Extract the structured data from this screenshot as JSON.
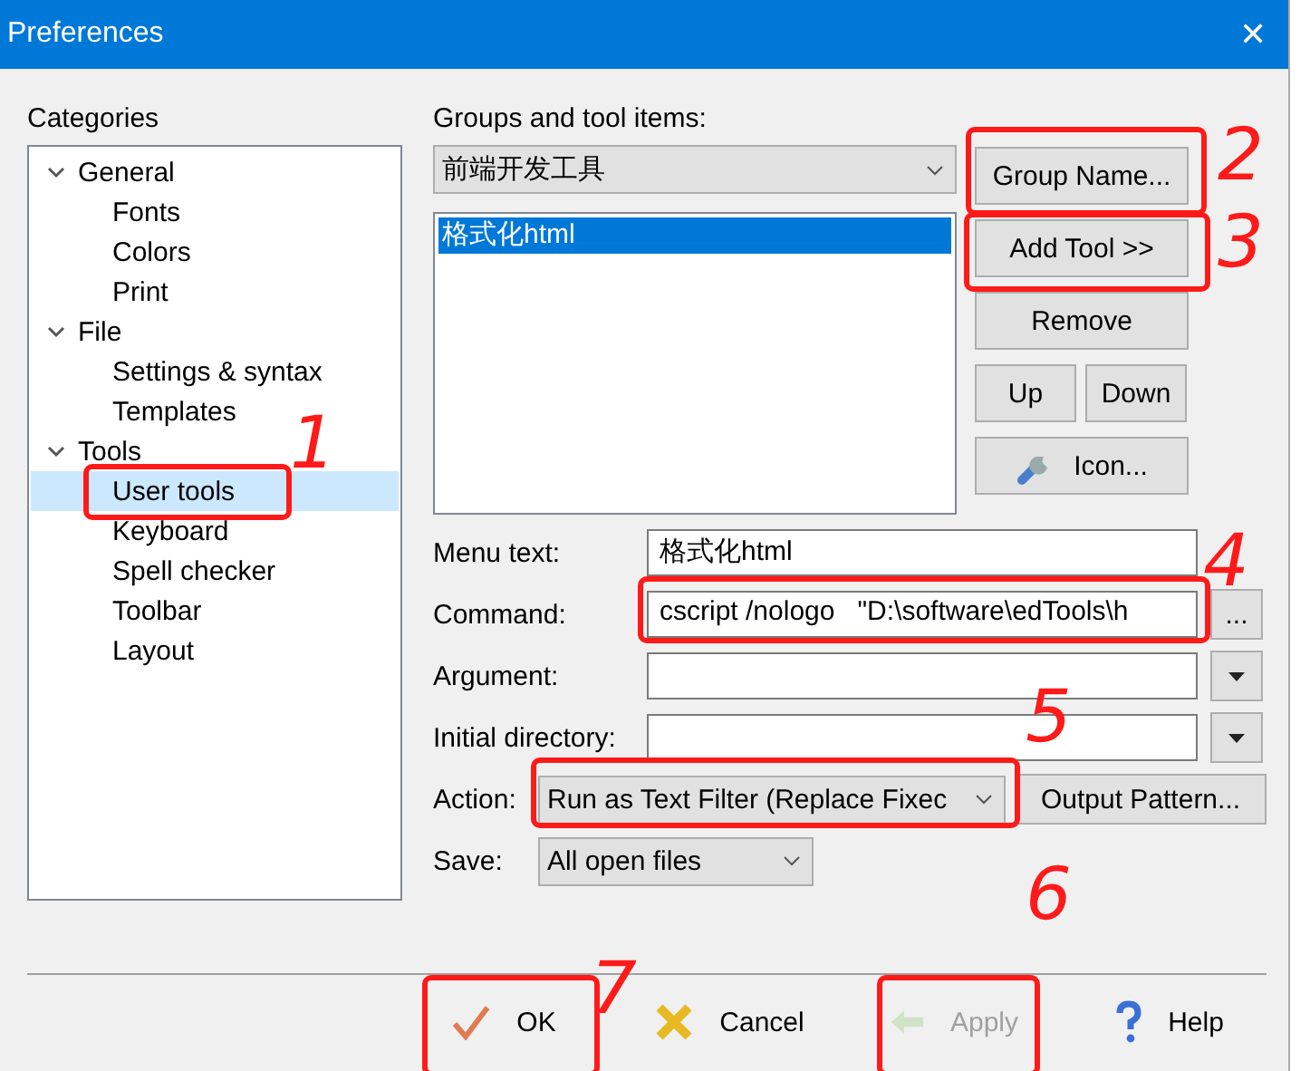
{
  "window": {
    "title": "Preferences",
    "close": "✕"
  },
  "categories": {
    "label": "Categories",
    "tree": [
      {
        "label": "General",
        "expanded": true,
        "selected": false,
        "children": [
          {
            "label": "Fonts",
            "selected": false
          },
          {
            "label": "Colors",
            "selected": false
          },
          {
            "label": "Print",
            "selected": false
          }
        ]
      },
      {
        "label": "File",
        "expanded": true,
        "selected": false,
        "children": [
          {
            "label": "Settings & syntax",
            "selected": false
          },
          {
            "label": "Templates",
            "selected": false
          }
        ]
      },
      {
        "label": "Tools",
        "expanded": true,
        "selected": false,
        "children": [
          {
            "label": "User tools",
            "selected": true
          },
          {
            "label": "Keyboard",
            "selected": false
          },
          {
            "label": "Spell checker",
            "selected": false
          },
          {
            "label": "Toolbar",
            "selected": false
          },
          {
            "label": "Layout",
            "selected": false
          }
        ]
      }
    ]
  },
  "groups": {
    "label": "Groups and tool items:",
    "group": "前端开发工具",
    "items": [
      {
        "label": "格式化html",
        "selected": true
      }
    ],
    "buttons": [
      {
        "label": "Group Name...",
        "kind": "wide"
      },
      {
        "label": "Add Tool >>",
        "kind": "wide"
      },
      {
        "label": "Remove",
        "kind": "wide"
      },
      {
        "label": "Up",
        "kind": "half"
      },
      {
        "label": "Down",
        "kind": "half"
      },
      {
        "label": "Icon...",
        "kind": "icon"
      }
    ]
  },
  "fields": [
    {
      "label": "Menu text:",
      "value": "格式化html",
      "kind": "text"
    },
    {
      "label": "Command:",
      "value": "cscript /nologo   \"D:\\software\\edTools\\h",
      "kind": "browse",
      "button": "..."
    },
    {
      "label": "Argument:",
      "kind": "menu"
    },
    {
      "label": "Initial directory:",
      "kind": "menu"
    }
  ],
  "action": {
    "label": "Action:",
    "value": "Run as Text Filter (Replace Fixec",
    "button": "Output Pattern..."
  },
  "save": {
    "label": "Save:",
    "value": "All open files"
  },
  "footer": [
    {
      "label": "OK",
      "kind": "ok",
      "disabled": false
    },
    {
      "label": "Cancel",
      "kind": "cancel",
      "disabled": false
    },
    {
      "label": "Apply",
      "kind": "apply",
      "disabled": true
    },
    {
      "label": "Help",
      "kind": "help",
      "disabled": false
    }
  ],
  "annotations": [
    "1",
    "2",
    "3",
    "4",
    "5",
    "6",
    "7"
  ]
}
